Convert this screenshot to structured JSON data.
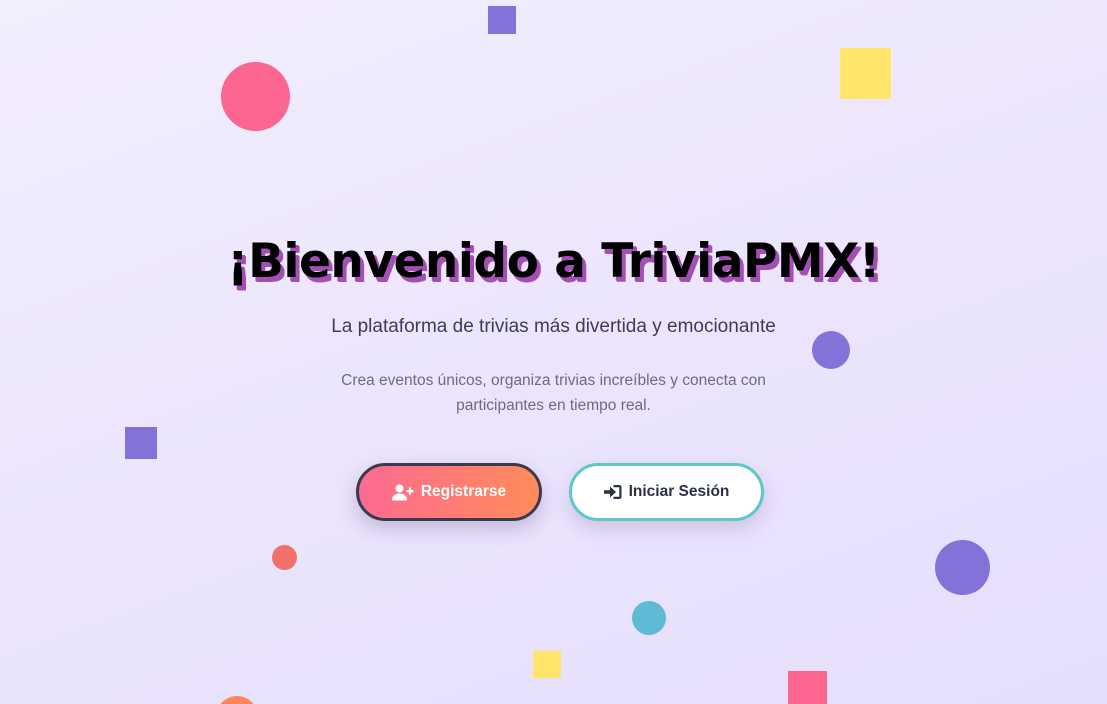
{
  "hero": {
    "title": "¡Bienvenido a TriviaPMX!",
    "subtitle": "La plataforma de trivias más divertida y emocionante",
    "description": "Crea eventos únicos, organiza trivias increíbles y conecta con participantes en tiempo real."
  },
  "actions": {
    "register": {
      "label": "Registrarse",
      "icon": "user-plus-icon"
    },
    "login": {
      "label": "Iniciar Sesión",
      "icon": "sign-in-icon"
    }
  },
  "colors": {
    "title_shadow": "#a44fb5",
    "register_gradient_start": "#fd6a92",
    "register_gradient_end": "#fe8c5a",
    "login_border": "#5cc8c8",
    "confetti": [
      "#fd6591",
      "#8472d8",
      "#ffe56b",
      "#f2706a",
      "#5ebad7",
      "#fe8658"
    ]
  }
}
